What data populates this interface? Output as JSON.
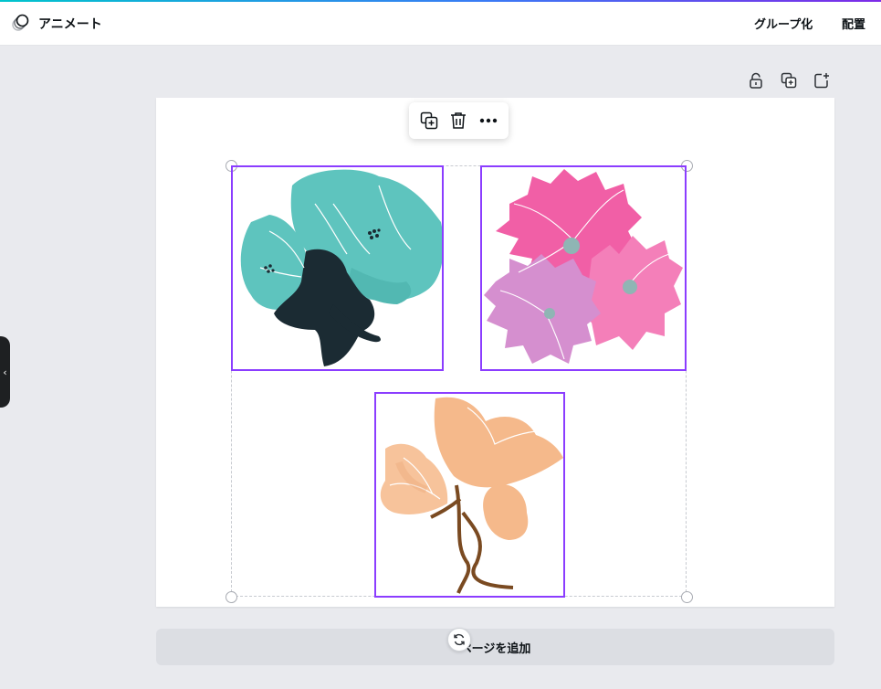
{
  "header": {
    "animate_label": "アニメート",
    "group_label": "グループ化",
    "arrange_label": "配置"
  },
  "side_handle": {
    "glyph": "‹"
  },
  "page_tools": [
    "lock-icon",
    "duplicate-page-icon",
    "add-page-icon"
  ],
  "float_toolbar": [
    "duplicate-icon",
    "trash-icon",
    "more-icon"
  ],
  "canvas": {
    "elements": [
      {
        "name": "teal-flower-graphic",
        "colors": [
          "#5ec4be",
          "#1b2b33"
        ]
      },
      {
        "name": "pink-flower-graphic",
        "colors": [
          "#f15fa6",
          "#d58fcf",
          "#f47fb9"
        ]
      },
      {
        "name": "peach-flower-graphic",
        "colors": [
          "#f5b98b",
          "#7a4a21"
        ]
      }
    ],
    "selection_color": "#8b3dff"
  },
  "add_page": {
    "label": "ページを追加"
  }
}
